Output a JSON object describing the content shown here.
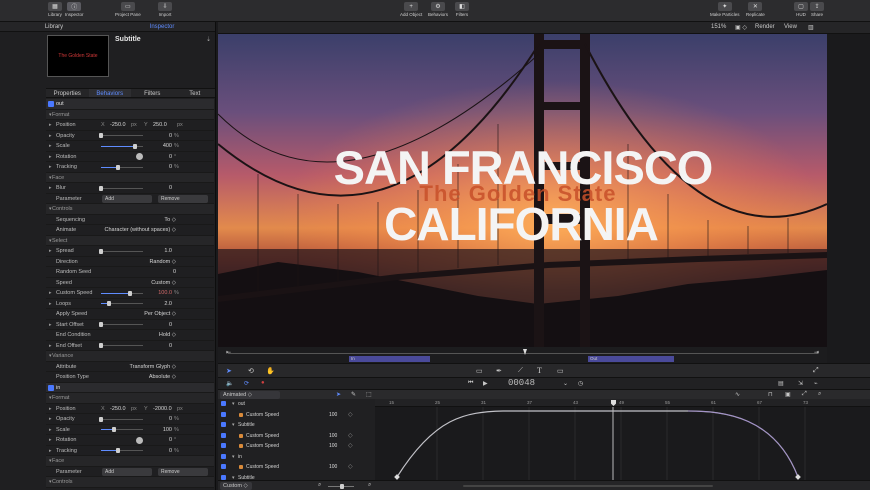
{
  "toolbar": {
    "library": "Library",
    "inspector": "Inspector",
    "project_pane": "Project Pane",
    "import": "Import",
    "add_object": "Add Object",
    "behaviors": "Behaviors",
    "filters": "Filters",
    "make_particles": "Make Particles",
    "replicate": "Replicate",
    "hud": "HUD",
    "share": "Share"
  },
  "panel_tabs": [
    "Library",
    "Inspector"
  ],
  "inspector": {
    "title": "Subtitle",
    "preview_text": "The Golden State",
    "tabs": [
      "Properties",
      "Behaviors",
      "Filters",
      "Text"
    ],
    "rows": [
      {
        "k": "head",
        "label": "out"
      },
      {
        "k": "sec",
        "label": "Format"
      },
      {
        "k": "xy",
        "label": "Position",
        "x_label": "X",
        "x": "-250.0",
        "x_unit": "px",
        "y_label": "Y",
        "y": "250.0",
        "y_unit": "px"
      },
      {
        "k": "slider",
        "label": "Opacity",
        "value": "0",
        "unit": "%",
        "level": 0.0
      },
      {
        "k": "slider",
        "label": "Scale",
        "value": "400",
        "unit": "%",
        "level": 0.8
      },
      {
        "k": "dial",
        "label": "Rotation",
        "value": "0",
        "unit": "°"
      },
      {
        "k": "slider",
        "label": "Tracking",
        "value": "0",
        "unit": "%",
        "level": 0.4
      },
      {
        "k": "sec",
        "label": "Face"
      },
      {
        "k": "slider",
        "label": "Blur",
        "value": "0",
        "unit": "",
        "level": 0.0
      },
      {
        "k": "pops",
        "label": "Parameter",
        "a": "Add",
        "b": "Remove"
      },
      {
        "k": "sec",
        "label": "Controls"
      },
      {
        "k": "text",
        "label": "Sequencing",
        "value": "To ◇"
      },
      {
        "k": "text",
        "label": "Animate",
        "value": "Character (without spaces) ◇"
      },
      {
        "k": "sec",
        "label": "Select"
      },
      {
        "k": "slider",
        "label": "Spread",
        "value": "1.0",
        "unit": "",
        "level": 0.0
      },
      {
        "k": "text",
        "label": "Direction",
        "value": "Random ◇"
      },
      {
        "k": "text",
        "label": "Random Seed",
        "value": "0"
      },
      {
        "k": "text",
        "label": "Speed",
        "value": "Custom ◇"
      },
      {
        "k": "slider",
        "label": "Custom Speed",
        "value": "100.0",
        "unit": "%",
        "level": 0.7,
        "accent": true
      },
      {
        "k": "slider",
        "label": "Loops",
        "value": "2.0",
        "unit": "",
        "level": 0.2
      },
      {
        "k": "text",
        "label": "Apply Speed",
        "value": "Per Object ◇"
      },
      {
        "k": "slider",
        "label": "Start Offset",
        "value": "0",
        "unit": "",
        "level": 0.0
      },
      {
        "k": "text",
        "label": "End Condition",
        "value": "Hold ◇"
      },
      {
        "k": "slider",
        "label": "End Offset",
        "value": "0",
        "unit": "",
        "level": 0.0
      },
      {
        "k": "sec",
        "label": "Variance"
      },
      {
        "k": "text",
        "label": "Attribute",
        "value": "Transform Glyph ◇"
      },
      {
        "k": "text",
        "label": "Position Type",
        "value": "Absolute ◇"
      },
      {
        "k": "head",
        "label": "in"
      },
      {
        "k": "sec",
        "label": "Format"
      },
      {
        "k": "xy",
        "label": "Position",
        "x_label": "X",
        "x": "-250.0",
        "x_unit": "px",
        "y_label": "Y",
        "y": "-2000.0",
        "y_unit": "px"
      },
      {
        "k": "slider",
        "label": "Opacity",
        "value": "0",
        "unit": "%",
        "level": 0.0
      },
      {
        "k": "slider",
        "label": "Scale",
        "value": "100",
        "unit": "%",
        "level": 0.3
      },
      {
        "k": "dial",
        "label": "Rotation",
        "value": "0",
        "unit": "°"
      },
      {
        "k": "slider",
        "label": "Tracking",
        "value": "0",
        "unit": "%",
        "level": 0.4
      },
      {
        "k": "sec",
        "label": "Face"
      },
      {
        "k": "pops",
        "label": "Parameter",
        "a": "Add",
        "b": "Remove"
      },
      {
        "k": "sec",
        "label": "Controls"
      }
    ]
  },
  "viewer": {
    "zoom": "151%",
    "render": "Render",
    "view": "View"
  },
  "canvas": {
    "line1": "SAN FRANCISCO",
    "line2": "CALIFORNIA",
    "subtitle": "The Golden State"
  },
  "markers": {
    "in": "In",
    "out": "Out"
  },
  "transport": {
    "timecode": "00048"
  },
  "timeline": {
    "dropdown": "Animated",
    "ruler": [
      "15",
      "25",
      "31",
      "37",
      "43",
      "49",
      "55",
      "61",
      "67",
      "73"
    ],
    "rows": [
      {
        "label": "out",
        "indent": 0,
        "group": true
      },
      {
        "label": "Custom Speed",
        "indent": 1,
        "value": "100"
      },
      {
        "label": "Subtitle",
        "indent": 0,
        "group": true
      },
      {
        "label": "Custom Speed",
        "indent": 1,
        "value": "100"
      },
      {
        "label": "Custom Speed",
        "indent": 1,
        "value": "100"
      },
      {
        "label": "in",
        "indent": 0,
        "group": true
      },
      {
        "label": "Custom Speed",
        "indent": 1,
        "value": "100"
      },
      {
        "label": "Subtitle",
        "indent": 0,
        "group": true
      }
    ],
    "footer_dropdown": "Custom"
  },
  "colors": {
    "accent": "#5f8cff",
    "marker": "#4a4a9a",
    "title": "#f4f4f4",
    "subtitle": "#c8502a"
  }
}
